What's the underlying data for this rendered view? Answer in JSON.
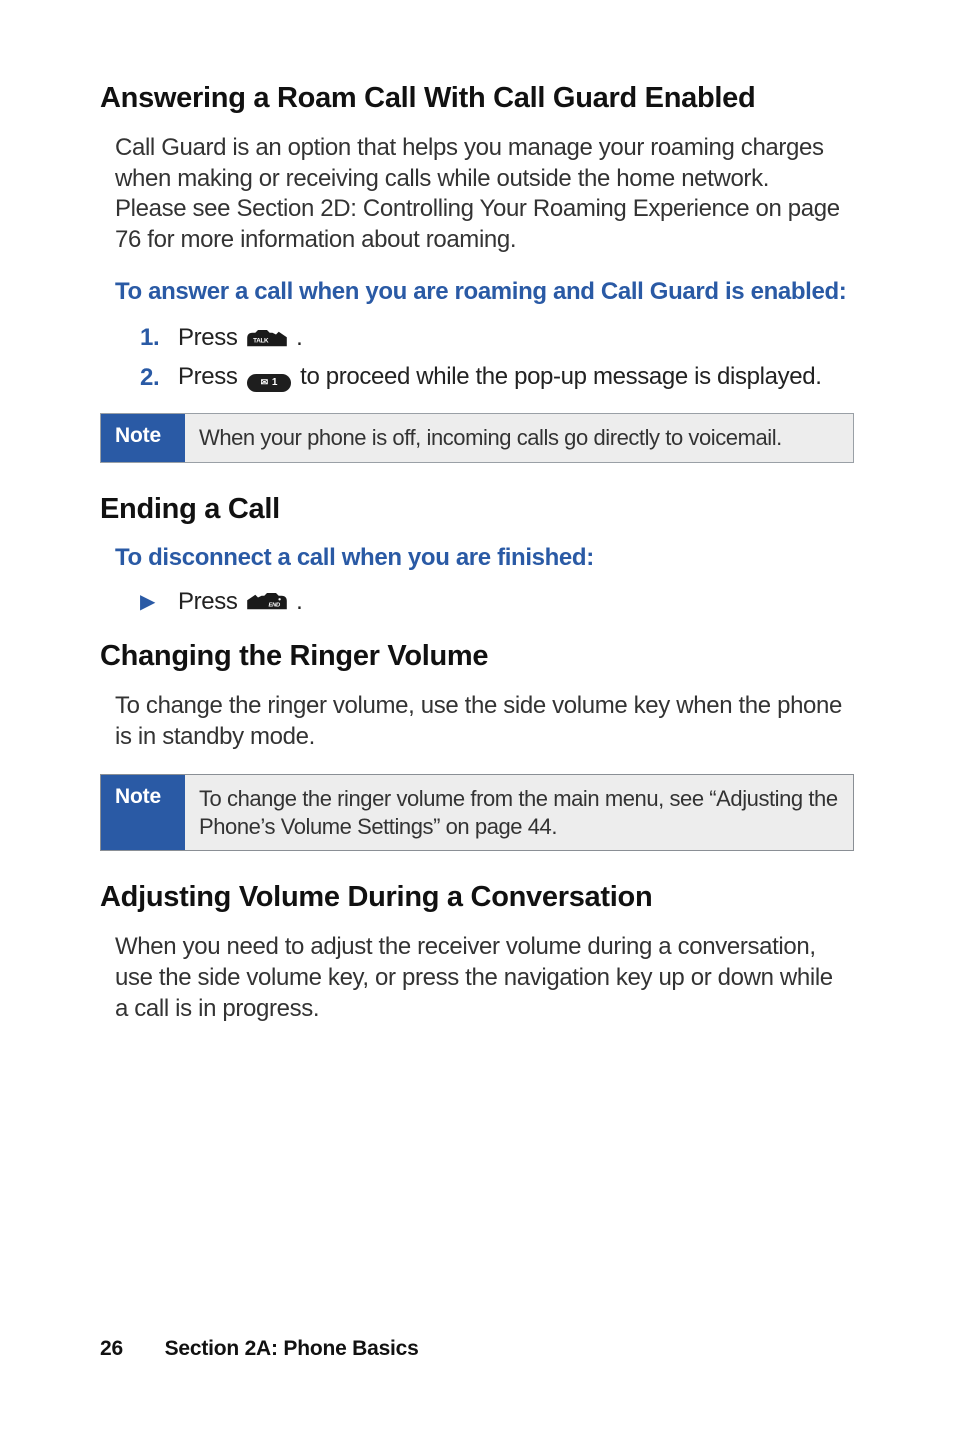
{
  "sec1": {
    "title": "Answering a Roam Call With Call Guard Enabled",
    "body": "Call Guard is an option that helps you manage your roaming charges when making or receiving calls while outside the home network. Please see Section 2D: Controlling Your Roaming Experience on page 76 for more information about roaming.",
    "subhead": "To answer a call when you are roaming and Call Guard is enabled:",
    "steps": {
      "s1num": "1.",
      "s1a": "Press ",
      "s1b": ".",
      "s2num": "2.",
      "s2a": "Press ",
      "s2b": " to proceed while the pop-up message is displayed."
    }
  },
  "keylabels": {
    "talk": "TALK",
    "end": "END",
    "pill_env": "✉",
    "pill_1": "1"
  },
  "note1": {
    "label": "Note",
    "text": "When your phone is off, incoming calls go directly to voicemail."
  },
  "sec2": {
    "title": "Ending a Call",
    "subhead": "To disconnect a call when you are finished:",
    "bullet": {
      "a": "Press ",
      "b": "."
    }
  },
  "sec3": {
    "title": "Changing the Ringer Volume",
    "body": "To change the ringer volume, use the side volume key when the phone is in standby mode."
  },
  "note2": {
    "label": "Note",
    "text": "To change the ringer volume from the main menu, see “Adjusting the Phone’s Volume Settings” on page 44."
  },
  "sec4": {
    "title": "Adjusting Volume During a Conversation",
    "body": "When you need to adjust the receiver volume during a conversation, use the side volume key, or press the navigation key up or down while a call is in progress."
  },
  "footer": {
    "page": "26",
    "section": "Section 2A: Phone Basics"
  }
}
